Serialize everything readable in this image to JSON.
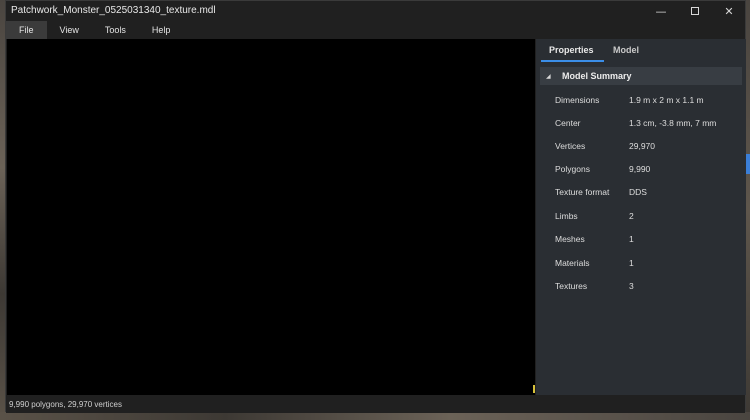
{
  "window": {
    "title": "Patchwork_Monster_0525031340_texture.mdl",
    "controls": {
      "minimize": "—",
      "close": "✕"
    }
  },
  "menu": {
    "items": [
      {
        "label": "File",
        "active": true
      },
      {
        "label": "View",
        "active": false
      },
      {
        "label": "Tools",
        "active": false
      },
      {
        "label": "Help",
        "active": false
      }
    ]
  },
  "panel": {
    "tabs": [
      {
        "label": "Properties",
        "selected": true
      },
      {
        "label": "Model",
        "selected": false
      }
    ],
    "section": {
      "title": "Model Summary",
      "toggle_glyph": "◢",
      "expanded": true
    },
    "properties": [
      {
        "key": "Dimensions",
        "value": "1.9 m x 2 m x 1.1 m"
      },
      {
        "key": "Center",
        "value": "1.3 cm, -3.8 mm, 7 mm"
      },
      {
        "key": "Vertices",
        "value": "29,970"
      },
      {
        "key": "Polygons",
        "value": "9,990"
      },
      {
        "key": "Texture format",
        "value": "DDS"
      },
      {
        "key": "Limbs",
        "value": "2"
      },
      {
        "key": "Meshes",
        "value": "1"
      },
      {
        "key": "Materials",
        "value": "1"
      },
      {
        "key": "Textures",
        "value": "3"
      }
    ]
  },
  "status": {
    "text": "9,990 polygons, 29,970 vertices"
  },
  "colors": {
    "accent": "#3b8ee8",
    "window_bg": "#202020",
    "panel_bg": "#2a2e33",
    "viewport_bg": "#000000"
  }
}
